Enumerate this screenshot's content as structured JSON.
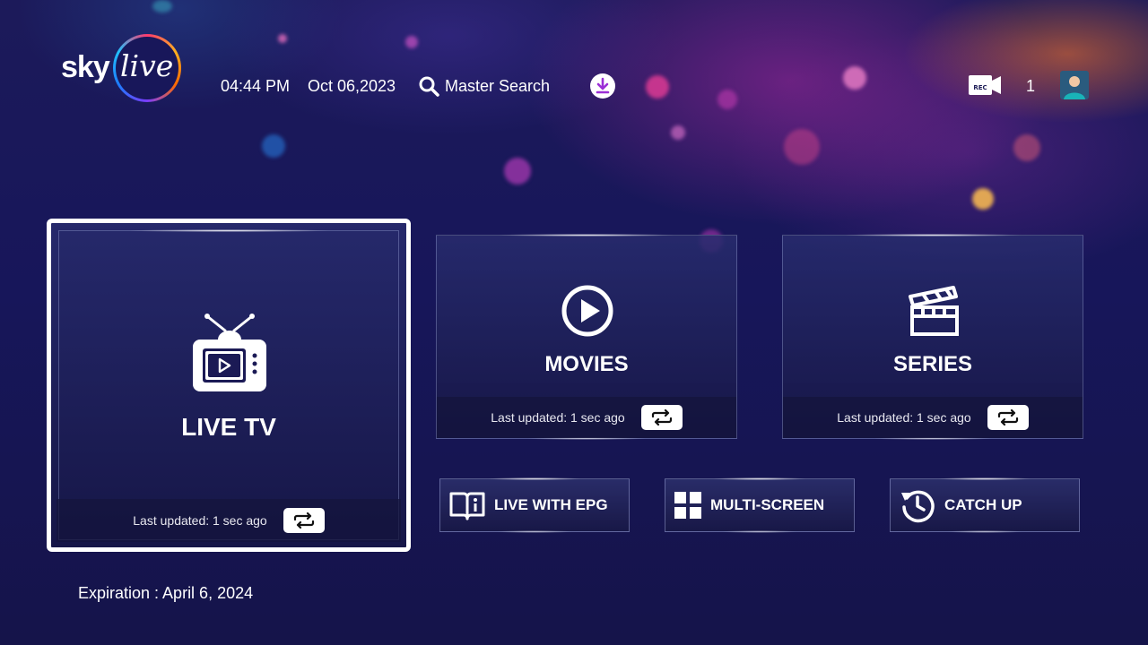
{
  "header": {
    "logo_sky": "sky",
    "logo_live": "live",
    "time": "04:44 PM",
    "date": "Oct 06,2023",
    "search_label": "Master Search",
    "rec_label": "REC",
    "profile_count": "1"
  },
  "tiles": {
    "live_tv": {
      "title": "LIVE TV",
      "updated": "Last updated: 1 sec ago"
    },
    "movies": {
      "title": "MOVIES",
      "updated": "Last updated: 1 sec ago"
    },
    "series": {
      "title": "SERIES",
      "updated": "Last updated: 1 sec ago"
    }
  },
  "shortcuts": {
    "live_with_epg": "LIVE WITH EPG",
    "multi_screen": "MULTI-SCREEN",
    "catch_up": "CATCH UP"
  },
  "footer": {
    "expiration": "Expiration : April 6, 2024"
  },
  "colors": {
    "background": "#16154a",
    "accent": "#ffffff",
    "download_icon": "#9b2fd6"
  }
}
